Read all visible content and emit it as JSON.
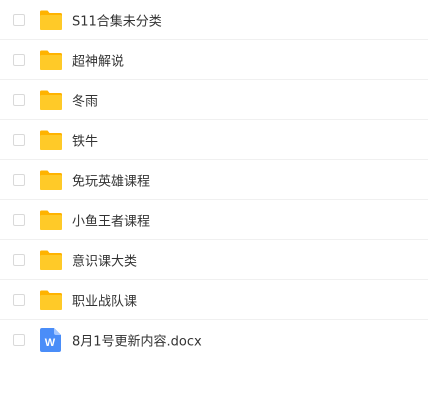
{
  "files": [
    {
      "name": "S11合集未分类",
      "type": "folder",
      "icon": "folder-icon"
    },
    {
      "name": "超神解说",
      "type": "folder",
      "icon": "folder-icon"
    },
    {
      "name": "冬雨",
      "type": "folder",
      "icon": "folder-icon"
    },
    {
      "name": "铁牛",
      "type": "folder",
      "icon": "folder-icon"
    },
    {
      "name": "免玩英雄课程",
      "type": "folder",
      "icon": "folder-icon"
    },
    {
      "name": "小鱼王者课程",
      "type": "folder",
      "icon": "folder-icon"
    },
    {
      "name": "意识课大类",
      "type": "folder",
      "icon": "folder-icon"
    },
    {
      "name": "职业战队课",
      "type": "folder",
      "icon": "folder-icon"
    },
    {
      "name": "8月1号更新内容.docx",
      "type": "docx",
      "icon": "word-document-icon",
      "badge": "W"
    }
  ],
  "colors": {
    "folder_front": "#FFCA28",
    "folder_back": "#FFB300",
    "word_blue": "#4A8DF8",
    "word_fold": "#A6C8FF"
  }
}
